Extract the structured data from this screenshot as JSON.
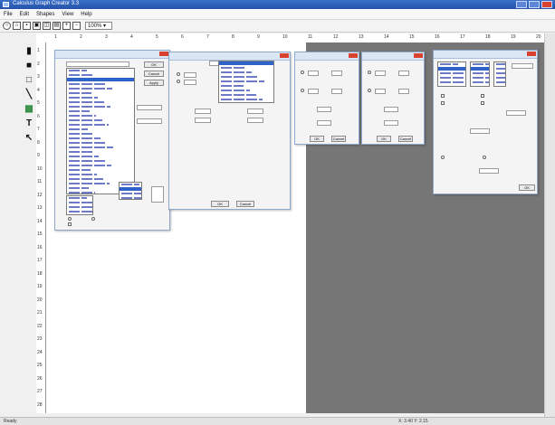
{
  "window": {
    "title": "Calculus Graph Creator 3.3",
    "menus": [
      "File",
      "Edit",
      "Shapes",
      "View",
      "Help"
    ]
  },
  "toolbar": {
    "buttons": [
      {
        "name": "new-icon",
        "glyph": "○"
      },
      {
        "name": "open-icon",
        "glyph": "⌂"
      },
      {
        "name": "save-icon",
        "glyph": "▪"
      },
      {
        "name": "print-icon",
        "glyph": "▣"
      },
      {
        "name": "copy-icon",
        "glyph": "◫"
      },
      {
        "name": "paste-icon",
        "glyph": "▤"
      },
      {
        "name": "zoom-in-icon",
        "glyph": "+"
      },
      {
        "name": "zoom-out-icon",
        "glyph": "−"
      }
    ],
    "zoom_value": "100%",
    "trailing_icon": "▾"
  },
  "ruler": {
    "h_ticks": [
      "1",
      "2",
      "3",
      "4",
      "5",
      "6",
      "7",
      "8",
      "9",
      "10",
      "11",
      "12",
      "13",
      "14",
      "15",
      "16",
      "17",
      "18",
      "19",
      "20"
    ],
    "v_ticks": [
      "1",
      "2",
      "3",
      "4",
      "5",
      "6",
      "7",
      "8",
      "9",
      "10",
      "11",
      "12",
      "13",
      "14",
      "15",
      "16",
      "17",
      "18",
      "19",
      "20",
      "21",
      "22",
      "23",
      "24",
      "25",
      "26",
      "27",
      "28"
    ]
  },
  "tools": [
    {
      "name": "line-style-tool",
      "glyph": "▮"
    },
    {
      "name": "fill-tool",
      "glyph": "■"
    },
    {
      "name": "rectangle-tool",
      "glyph": "□"
    },
    {
      "name": "line-tool",
      "glyph": "╲"
    },
    {
      "name": "image-tool",
      "glyph": "▩"
    },
    {
      "name": "text-tool",
      "glyph": "T"
    },
    {
      "name": "pointer-tool",
      "glyph": "↖"
    }
  ],
  "dialogs": {
    "d1": {
      "ok": "OK",
      "cancel": "Cancel",
      "apply": "Apply"
    },
    "d2": {
      "ok": "OK",
      "cancel": "Cancel"
    },
    "d3": {
      "ok": "OK",
      "cancel": "Cancel"
    },
    "d4": {
      "ok": "OK",
      "cancel": "Cancel"
    },
    "d5": {
      "ok": "OK"
    }
  },
  "status": {
    "left": "Ready",
    "right": "X: 3.40  Y: 2.15"
  },
  "colors": {
    "titlebar": "#2452a8",
    "canvas_gray": "#767676",
    "selection": "#2f63c9"
  }
}
